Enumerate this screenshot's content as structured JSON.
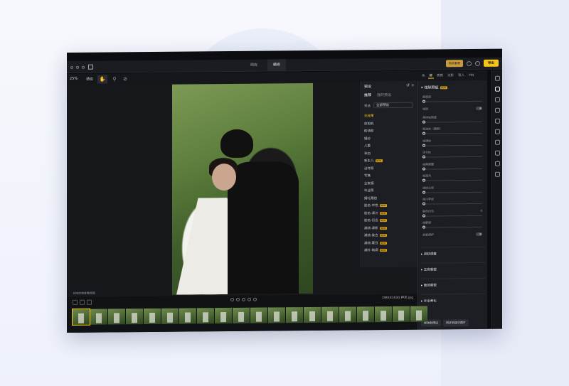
{
  "window": {
    "tabs": [
      "图库",
      "精修"
    ],
    "active_tab": 1,
    "vip_label": "购买套餐",
    "export_label": "导出"
  },
  "toolbar": {
    "zoom": "25%",
    "fit": "适应"
  },
  "preset_panel": {
    "title": "预设",
    "tabs": [
      "推荐",
      "我的预设"
    ],
    "filter_label": "筛选",
    "filter_value": "全部预设",
    "items": [
      {
        "label": "无效果",
        "selected": true,
        "new": false
      },
      {
        "label": "原相机",
        "selected": false,
        "new": false
      },
      {
        "label": "韵油胶",
        "selected": false,
        "new": false
      },
      {
        "label": "婚纱",
        "selected": false,
        "new": false
      },
      {
        "label": "儿童",
        "selected": false,
        "new": false
      },
      {
        "label": "孕妇",
        "selected": false,
        "new": false
      },
      {
        "label": "新生儿",
        "selected": false,
        "new": true
      },
      {
        "label": "证件照",
        "selected": false,
        "new": false
      },
      {
        "label": "写真",
        "selected": false,
        "new": false
      },
      {
        "label": "全家福",
        "selected": false,
        "new": false
      },
      {
        "label": "毕业照",
        "selected": false,
        "new": false
      },
      {
        "label": "婚礼跟拍",
        "selected": false,
        "new": false
      },
      {
        "label": "胶色-中性",
        "selected": false,
        "new": true
      },
      {
        "label": "胶色-清冷",
        "selected": false,
        "new": true
      },
      {
        "label": "胶色-日出",
        "selected": false,
        "new": true
      },
      {
        "label": "潮流-清新",
        "selected": false,
        "new": true
      },
      {
        "label": "潮流-复古",
        "selected": false,
        "new": true
      },
      {
        "label": "潮流-夏日",
        "selected": false,
        "new": true
      },
      {
        "label": "潮片-暗调",
        "selected": false,
        "new": true
      }
    ]
  },
  "right_panel": {
    "tabs": [
      "色",
      "修",
      "质感",
      "光影",
      "导入",
      "PIN"
    ],
    "active_tab": 1,
    "section_title": "祛除瑕疵",
    "rows": [
      {
        "label": "痘痘痣",
        "type": "slider",
        "value": ""
      },
      {
        "label": "祛斑",
        "type": "toggle",
        "value": ""
      },
      {
        "label": "身体祛瑕疵",
        "type": "slider",
        "value": ""
      },
      {
        "label": "祛油光（面部）",
        "type": "slider",
        "value": ""
      },
      {
        "label": "祛颈纹",
        "type": "slider",
        "value": ""
      },
      {
        "label": "法令纹",
        "type": "slider",
        "value": ""
      },
      {
        "label": "祛黑眼圈",
        "type": "slider",
        "value": ""
      },
      {
        "label": "祛泪沟",
        "type": "slider",
        "value": ""
      },
      {
        "label": "祛抬头纹",
        "type": "slider",
        "value": ""
      },
      {
        "label": "祛川字纹",
        "type": "slider",
        "value": ""
      },
      {
        "label": "肤色均匀",
        "type": "slider",
        "value": "0"
      },
      {
        "label": "祛眼袋",
        "type": "slider",
        "value": ""
      },
      {
        "label": "全脸保护",
        "type": "toggle",
        "value": ""
      }
    ],
    "sections": [
      "皮肤调整",
      "五官重塑",
      "面部重塑",
      "手全美化"
    ],
    "footer": [
      "修改新预设",
      "同步到选中图片"
    ]
  },
  "canvas": {
    "hint": "长按空格查看原图"
  },
  "filmstrip": {
    "filename": "DMXK3030 押克.jpg",
    "thumb_count": 20
  }
}
